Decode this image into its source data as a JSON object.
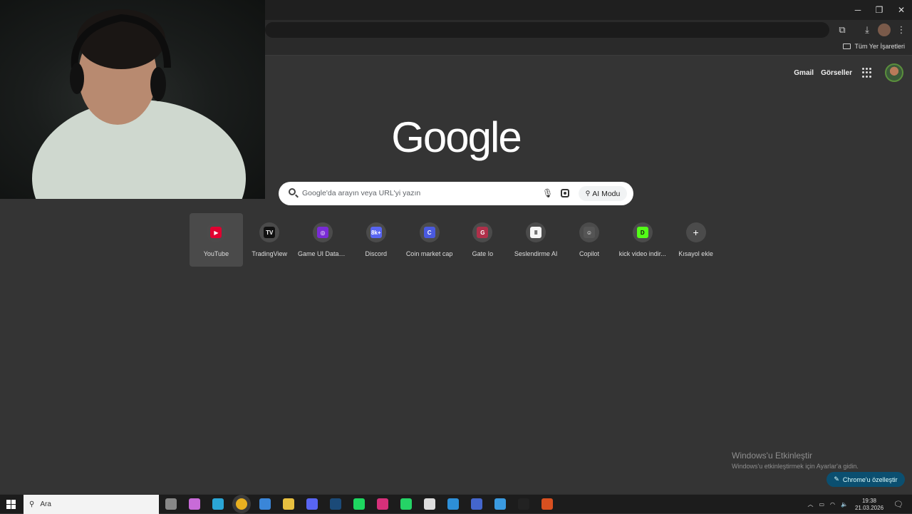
{
  "browser": {
    "bookmarks_all": "Tüm Yer İşaretleri",
    "colors": {
      "frame": "#1f1f1f",
      "toolbar": "#2a2a2a",
      "page_bg": "#343434"
    }
  },
  "header": {
    "gmail": "Gmail",
    "images": "Görseller"
  },
  "logo": "Google",
  "search": {
    "placeholder": "Google'da arayın veya URL'yi yazın",
    "ai_mode": "AI Modu"
  },
  "shortcuts": [
    {
      "label": "YouTube",
      "icon": "youtube-icon",
      "glyph": "▶",
      "color": "#e00030"
    },
    {
      "label": "TradingView",
      "icon": "tradingview-icon",
      "glyph": "TV",
      "color": "#111111"
    },
    {
      "label": "Game UI Datab...",
      "icon": "gameui-icon",
      "glyph": "◎",
      "color": "#7a2bd6"
    },
    {
      "label": "Discord",
      "icon": "discord-icon",
      "glyph": "8k+",
      "color": "#5865f2"
    },
    {
      "label": "Coin market cap",
      "icon": "coinmarketcap-icon",
      "glyph": "C",
      "color": "#4a5ae0"
    },
    {
      "label": "Gate Io",
      "icon": "gateio-icon",
      "glyph": "G",
      "color": "#b0304a"
    },
    {
      "label": "Seslendirme AI",
      "icon": "seslendirme-icon",
      "glyph": "II",
      "color": "#f5f5f5"
    },
    {
      "label": "Copilot",
      "icon": "copilot-icon",
      "glyph": "☺",
      "color": "#555555"
    },
    {
      "label": "kick video indir...",
      "icon": "kick-icon",
      "glyph": "D",
      "color": "#53fc18"
    },
    {
      "label": "Kısayol ekle",
      "icon": "add-shortcut-icon",
      "glyph": "+",
      "color": "transparent"
    }
  ],
  "watermark": {
    "title": "Windows'u Etkinleştir",
    "subtitle": "Windows'u etkinleştirmek için Ayarlar'a gidin."
  },
  "customize": {
    "label": "Chrome'u özelleştir"
  },
  "taskbar": {
    "search_label": "Ara",
    "time": "19:38",
    "date": "21.03.2026",
    "apps": [
      {
        "icon": "task-view-icon",
        "color": "#888888"
      },
      {
        "icon": "copilot-app-icon",
        "color": "#c86bd8"
      },
      {
        "icon": "edge-icon",
        "color": "#2aa6d6"
      },
      {
        "icon": "chrome-icon",
        "color": "#e8b020"
      },
      {
        "icon": "mail-icon",
        "color": "#3a86d8"
      },
      {
        "icon": "file-explorer-icon",
        "color": "#e8c040"
      },
      {
        "icon": "discord-app-icon",
        "color": "#5865f2"
      },
      {
        "icon": "steam-icon",
        "color": "#1b4a78"
      },
      {
        "icon": "spotify-icon",
        "color": "#1ed760"
      },
      {
        "icon": "instagram-icon",
        "color": "#d6307a"
      },
      {
        "icon": "whatsapp-icon",
        "color": "#25d366"
      },
      {
        "icon": "notepad-icon",
        "color": "#dddddd"
      },
      {
        "icon": "vscode-icon",
        "color": "#2d8fd8"
      },
      {
        "icon": "arc-icon",
        "color": "#4466cc"
      },
      {
        "icon": "paint-icon",
        "color": "#3a9ae0"
      },
      {
        "icon": "obs-icon",
        "color": "#222222"
      },
      {
        "icon": "game-icon",
        "color": "#d85020"
      }
    ]
  }
}
